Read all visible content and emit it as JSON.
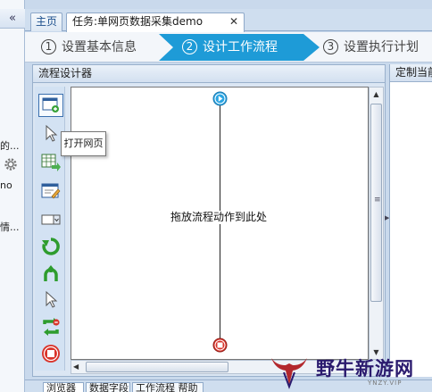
{
  "left_strip": {
    "collapse_label": "«",
    "fragments": [
      "的...",
      "no",
      "情..."
    ]
  },
  "tabs": {
    "home": "主页",
    "task": "任务:单网页数据采集demo",
    "close": "✕"
  },
  "wizard": {
    "steps": [
      {
        "num": "1",
        "label": "设置基本信息"
      },
      {
        "num": "2",
        "label": "设计工作流程"
      },
      {
        "num": "3",
        "label": "设置执行计划"
      }
    ],
    "active_color": "#1e9bd7"
  },
  "designer": {
    "title": "流程设计器",
    "tooltip": "打开网页",
    "drop_hint": "拖放流程动作到此处",
    "tools": [
      "open-page-icon",
      "click-element-icon",
      "extract-data-icon",
      "input-text-icon",
      "select-dropdown-icon",
      "loop-icon",
      "branch-icon",
      "mouse-hover-icon",
      "loop-click-icon",
      "stop-icon"
    ]
  },
  "right_panel": {
    "title": "定制当前"
  },
  "bottom_tabs": [
    "浏览器",
    "数据字段",
    "工作流程 帮助"
  ],
  "watermark": {
    "brand": "野牛新游网",
    "sub": "YNZY.VIP"
  }
}
